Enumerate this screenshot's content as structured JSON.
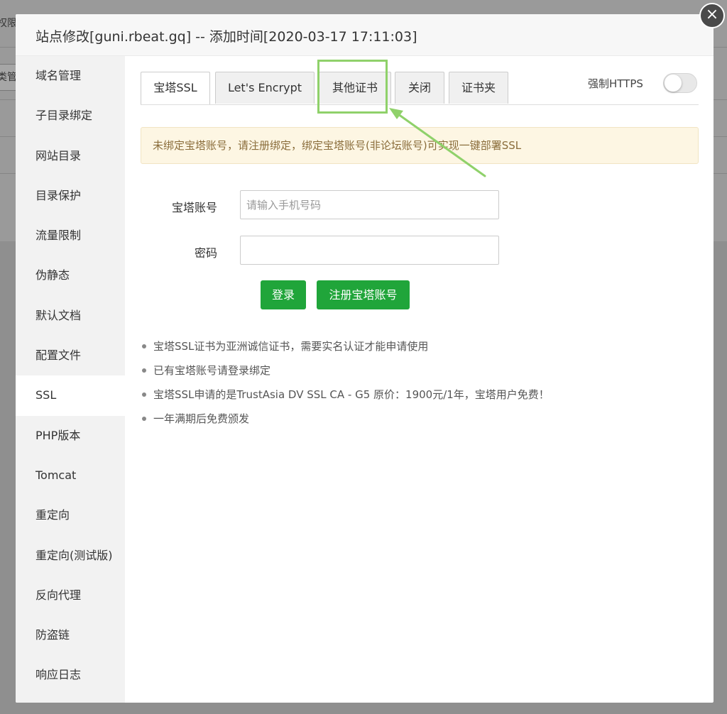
{
  "background": {
    "fragment_1": "权限",
    "fragment_2": "类管"
  },
  "modal": {
    "title": "站点修改[guni.rbeat.gq] -- 添加时间[2020-03-17 17:11:03]",
    "close_label": "×"
  },
  "sidebar": {
    "items": [
      {
        "label": "域名管理"
      },
      {
        "label": "子目录绑定"
      },
      {
        "label": "网站目录"
      },
      {
        "label": "目录保护"
      },
      {
        "label": "流量限制"
      },
      {
        "label": "伪静态"
      },
      {
        "label": "默认文档"
      },
      {
        "label": "配置文件"
      },
      {
        "label": "SSL"
      },
      {
        "label": "PHP版本"
      },
      {
        "label": "Tomcat"
      },
      {
        "label": "重定向"
      },
      {
        "label": "重定向(测试版)"
      },
      {
        "label": "反向代理"
      },
      {
        "label": "防盗链"
      },
      {
        "label": "响应日志"
      }
    ],
    "active": "SSL"
  },
  "tabs": {
    "items": [
      {
        "label": "宝塔SSL"
      },
      {
        "label": "Let's Encrypt"
      },
      {
        "label": "其他证书"
      },
      {
        "label": "关闭"
      },
      {
        "label": "证书夹"
      }
    ],
    "active": "宝塔SSL"
  },
  "force_https": {
    "label": "强制HTTPS",
    "enabled": false
  },
  "notice": {
    "text": "未绑定宝塔账号，请注册绑定，绑定宝塔账号(非论坛账号)可实现一键部署SSL"
  },
  "form": {
    "account_label": "宝塔账号",
    "account_placeholder": "请输入手机号码",
    "account_value": "",
    "password_label": "密码",
    "password_value": "",
    "login_button": "登录",
    "register_button": "注册宝塔账号"
  },
  "info_list": [
    "宝塔SSL证书为亚洲诚信证书，需要实名认证才能申请使用",
    "已有宝塔账号请登录绑定",
    "宝塔SSL申请的是TrustAsia DV SSL CA - G5 原价：1900元/1年，宝塔用户免费！",
    "一年满期后免费颁发"
  ],
  "colors": {
    "accent_green": "#20a53a",
    "annotation_green": "#8fd16a",
    "notice_bg": "#fdf6e3",
    "notice_text": "#8a6d3b",
    "overlay": "#8f8f8f"
  }
}
